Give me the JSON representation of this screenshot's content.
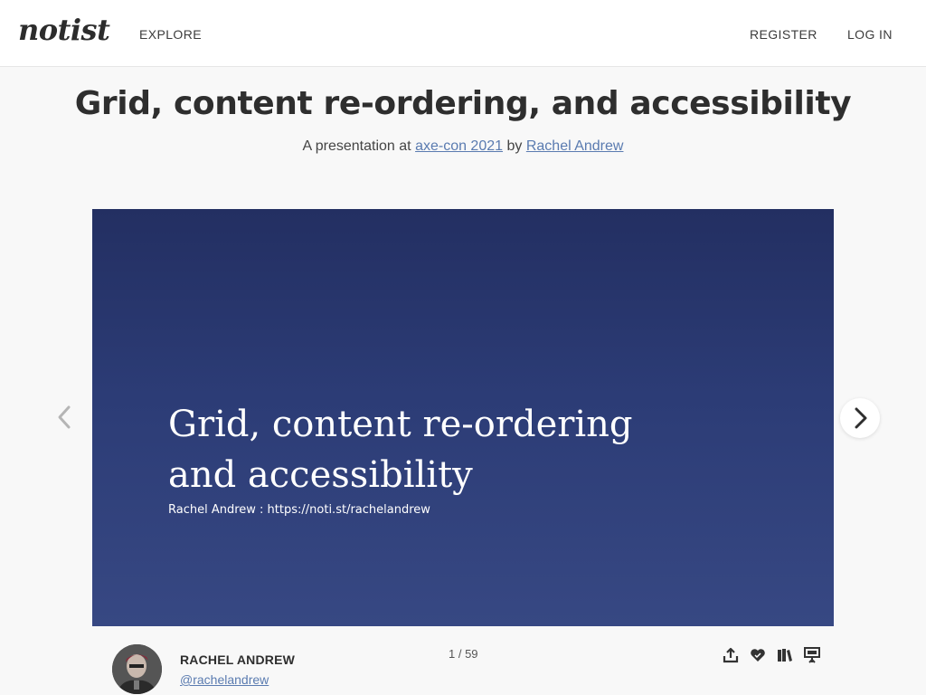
{
  "header": {
    "logo": "notist",
    "nav": {
      "explore": "EXPLORE",
      "register": "REGISTER",
      "login": "LOG IN"
    }
  },
  "presentation": {
    "title": "Grid, content re-ordering, and accessibility",
    "subtitle_prefix": "A presentation at",
    "event": "axe-con 2021",
    "by": "by",
    "speaker": "Rachel Andrew"
  },
  "slide": {
    "title_line1": "Grid, content re-ordering",
    "title_line2": "and accessibility",
    "byline": "Rachel Andrew : https://noti.st/rachelandrew",
    "gradient_top": "#232f62",
    "gradient_bottom": "#374883"
  },
  "author": {
    "name": "RACHEL ANDREW",
    "handle": "@rachelandrew"
  },
  "pagination": {
    "current": 1,
    "total": 59,
    "label": "1 / 59"
  },
  "actions": [
    {
      "icon": "share-icon"
    },
    {
      "icon": "heart-icon"
    },
    {
      "icon": "book-icon"
    },
    {
      "icon": "presentation-icon"
    }
  ],
  "colors": {
    "link": "#5a7bb0",
    "text_dark": "#2e2e2e",
    "page_bg": "#f8f8f8"
  }
}
